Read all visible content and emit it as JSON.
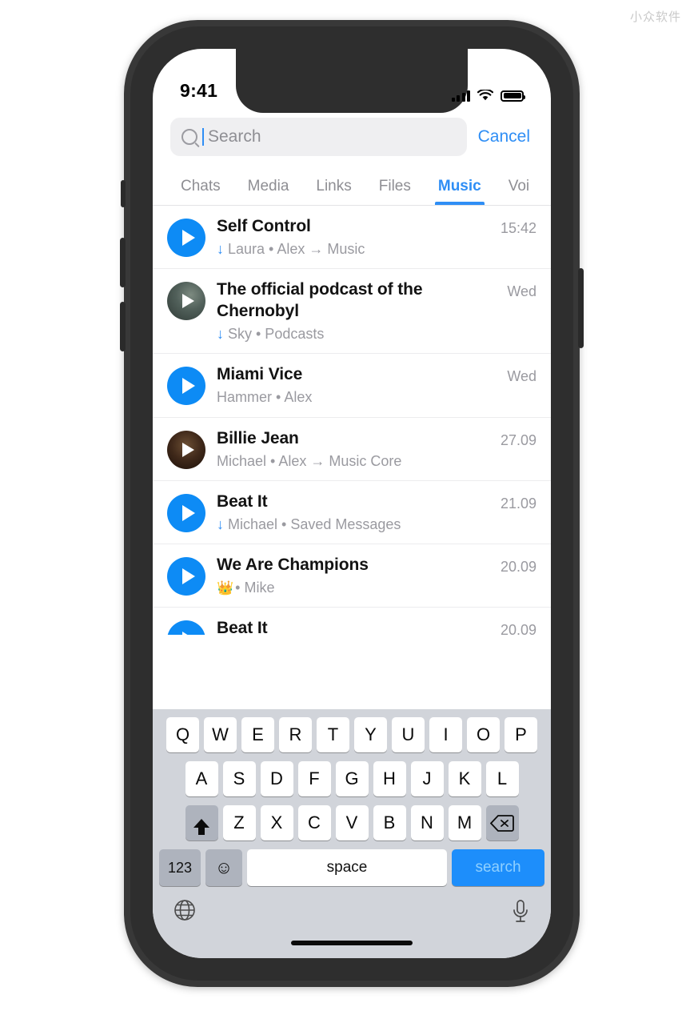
{
  "watermark": "小众软件",
  "status_bar": {
    "time": "9:41",
    "icons": [
      "signal-icon",
      "wifi-icon",
      "battery-icon"
    ]
  },
  "search": {
    "placeholder": "Search",
    "value": "",
    "cancel_label": "Cancel",
    "icon": "search-icon"
  },
  "tabs": [
    {
      "label": "Chats",
      "active": false
    },
    {
      "label": "Media",
      "active": false
    },
    {
      "label": "Links",
      "active": false
    },
    {
      "label": "Files",
      "active": false
    },
    {
      "label": "Music",
      "active": true
    },
    {
      "label": "Voi",
      "active": false
    }
  ],
  "results": [
    {
      "title": "Self Control",
      "downloaded": true,
      "emoji": "",
      "subtitle": "Laura • Alex → Music",
      "time": "15:42",
      "thumb": "play-blue"
    },
    {
      "title": "The official podcast of the Chernobyl",
      "downloaded": true,
      "emoji": "",
      "subtitle": "Sky • Podcasts",
      "time": "Wed",
      "thumb": "photo-dark-green"
    },
    {
      "title": "Miami Vice",
      "downloaded": false,
      "emoji": "",
      "subtitle": "Hammer • Alex",
      "time": "Wed",
      "thumb": "play-blue"
    },
    {
      "title": "Billie Jean",
      "downloaded": false,
      "emoji": "",
      "subtitle": "Michael • Alex → Music Core",
      "time": "27.09",
      "thumb": "photo-brown"
    },
    {
      "title": "Beat It",
      "downloaded": true,
      "emoji": "",
      "subtitle": "Michael • Saved Messages",
      "time": "21.09",
      "thumb": "play-blue"
    },
    {
      "title": "We Are Champions",
      "downloaded": false,
      "emoji": "👑",
      "subtitle": "• Mike",
      "time": "20.09",
      "thumb": "play-blue"
    },
    {
      "title": "Beat It",
      "downloaded": false,
      "emoji": "",
      "subtitle": "",
      "time": "20.09",
      "thumb": "play-blue"
    }
  ],
  "keyboard": {
    "row1": [
      "Q",
      "W",
      "E",
      "R",
      "T",
      "Y",
      "U",
      "I",
      "O",
      "P"
    ],
    "row2": [
      "A",
      "S",
      "D",
      "F",
      "G",
      "H",
      "J",
      "K",
      "L"
    ],
    "row3": [
      "Z",
      "X",
      "C",
      "V",
      "B",
      "N",
      "M"
    ],
    "shift_icon": "shift-icon",
    "backspace_icon": "backspace-icon",
    "numbers_label": "123",
    "emoji_icon": "emoji-icon",
    "space_label": "space",
    "action_label": "search",
    "globe_icon": "globe-icon",
    "mic_icon": "microphone-icon"
  },
  "colors": {
    "accent": "#2f8ef5",
    "play_blue": "#0d8bf5",
    "action_key": "#1d8efb",
    "keyboard_bg": "#d1d4da",
    "subtitle_gray": "#9a9aa0"
  }
}
